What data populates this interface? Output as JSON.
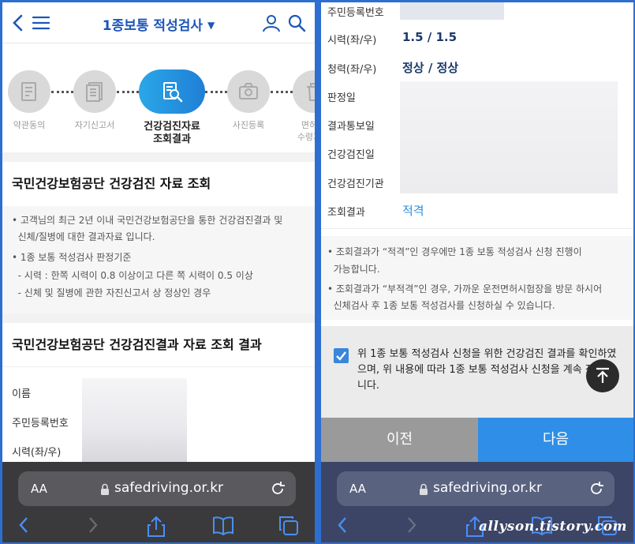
{
  "left": {
    "header": {
      "title": "1종보통 적성검사"
    },
    "steps": [
      {
        "label": "약관동의",
        "icon": "document-icon"
      },
      {
        "label": "자기신고서",
        "icon": "list-document-icon"
      },
      {
        "label": "건강검진자료\n조회결과",
        "icon": "search-document-icon"
      },
      {
        "label": "사진등록",
        "icon": "camera-icon"
      },
      {
        "label": "면허\n수령지",
        "icon": "trash-icon"
      }
    ],
    "section1": {
      "title": "국민건강보험공단 건강검진 자료 조회",
      "notices": [
        "• 고객님의 최근 2년 이내 국민건강보험공단을 통한 건강검진결과 및",
        "  신체/질병에 대한 결과자료 입니다.",
        "• 1종 보통 적성검사 판정기준",
        "  - 시력 : 한쪽 시력이 0.8 이상이고 다른 쪽 시력이 0.5 이상",
        "  - 신체 및 질병에 관한 자진신고서 상 정상인 경우"
      ]
    },
    "section2": {
      "title": "국민건강보험공단 건강검진결과 자료 조회 결과",
      "rows": [
        "이름",
        "주민등록번호",
        "시력(좌/우)"
      ]
    },
    "browser": {
      "aa": "AA",
      "url": "safedriving.or.kr"
    }
  },
  "right": {
    "rows": [
      {
        "label": "주민등록번호",
        "value": ""
      },
      {
        "label": "시력(좌/우)",
        "value": "1.5 / 1.5"
      },
      {
        "label": "청력(좌/우)",
        "value": "정상 / 정상"
      },
      {
        "label": "판정일",
        "value": ""
      },
      {
        "label": "결과통보일",
        "value": ""
      },
      {
        "label": "건강검진일",
        "value": ""
      },
      {
        "label": "건강검진기관",
        "value": ""
      },
      {
        "label": "조회결과",
        "value": "적격"
      }
    ],
    "notices": [
      "• 조회결과가 “적격”인 경우에만 1종 보통 적성검사 신청 진행이",
      "  가능합니다.",
      "• 조회결과가 “부적격”인 경우, 가까운 운전면허시험장을 방문 하시어",
      "  신체검사 후 1종 보통 적성검사를 신청하실 수 있습니다."
    ],
    "confirm": {
      "checked": true,
      "text": "위 1종 보통 적성검사 신청을 위한 건강검진 결과를 확인하였으며, 위 내용에 따라 1종 보통 적성검사 신청을 계속 진행합니다."
    },
    "buttons": {
      "prev": "이전",
      "next": "다음"
    },
    "browser": {
      "aa": "AA",
      "url": "safedriving.or.kr"
    },
    "watermark": "allyson.tistory.com"
  },
  "colors": {
    "brand_blue": "#2c6fd1",
    "active_step": "#2aa7e8",
    "next_button": "#2f8fe8",
    "result_blue": "#2f8ee0"
  }
}
